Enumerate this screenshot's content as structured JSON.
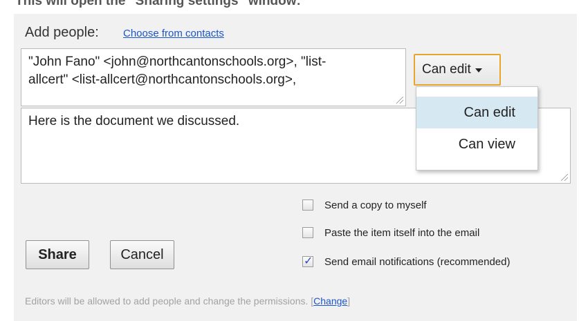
{
  "caption": {
    "text": "This will open the \"Sharing settings\" window:"
  },
  "add_people": {
    "label": "Add people:",
    "choose_link": "Choose from contacts",
    "recipients_line1": "\"John Fano\" <john@northcantonschools.org>, \"list-",
    "recipients_line2": "allcert\" <list-allcert@northcantonschools.org>,"
  },
  "permission": {
    "selected": "Can edit",
    "options": [
      "Can edit",
      "Can view"
    ]
  },
  "message": {
    "value": "Here is the document we discussed."
  },
  "options": [
    {
      "label": "Send a copy to myself",
      "checked": false
    },
    {
      "label": "Paste the item itself into the email",
      "checked": false
    },
    {
      "label": "Send email notifications (recommended)",
      "checked": true
    }
  ],
  "buttons": {
    "share": "Share",
    "cancel": "Cancel"
  },
  "footer": {
    "note": "Editors will be allowed to add people and change the permissions.",
    "bracket_open": "[",
    "change_link": "Change",
    "bracket_close": "]"
  }
}
